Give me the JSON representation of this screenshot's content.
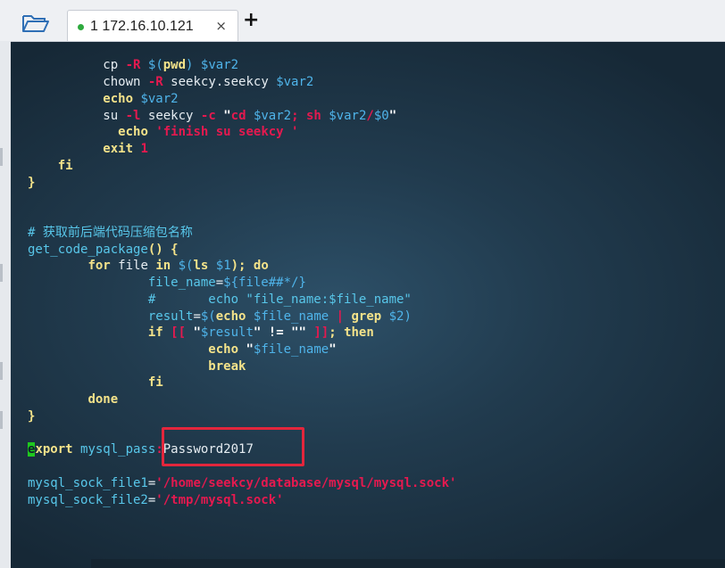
{
  "toolbar": {
    "folder_icon": "folder-open-icon"
  },
  "tabs": [
    {
      "status": "connected",
      "status_color": "#2eaa3e",
      "label": "1 172.16.10.121",
      "close": "×"
    }
  ],
  "new_tab_label": "+",
  "terminal": {
    "background": "#213b4e",
    "lines": {
      "l1": {
        "a": "cp ",
        "b": "-R ",
        "c": "$(",
        "d": "pwd",
        "e": ") ",
        "f": "$var2"
      },
      "l2": {
        "a": "chown ",
        "b": "-R ",
        "c": "seekcy.seekcy ",
        "d": "$var2"
      },
      "l3": {
        "a": "echo ",
        "b": "$var2"
      },
      "l4": {
        "a": "su ",
        "b": "-l ",
        "c": "seekcy ",
        "d": "-c ",
        "e": "\"",
        "f": "cd ",
        "g": "$var2",
        "h": "; ",
        "i": "sh ",
        "j": "$var2",
        "k": "/",
        "l": "$0",
        "m": "\""
      },
      "l5": {
        "a": "echo ",
        "b": "'finish su seekcy '"
      },
      "l6": {
        "a": "exit ",
        "b": "1"
      },
      "l7": {
        "a": "fi"
      },
      "l8": {
        "a": "}"
      },
      "l9": {
        "a": "# 获取前后端代码压缩包名称"
      },
      "l10": {
        "a": "get_code_package",
        "b": "() {"
      },
      "l11": {
        "a": "for ",
        "b": "file ",
        "c": "in ",
        "d": "$(",
        "e": "ls ",
        "f": "$1",
        "g": "); ",
        "h": "do"
      },
      "l12": {
        "a": "file_name",
        "b": "=",
        "c": "${file##*/}"
      },
      "l13": {
        "a": "#       echo \"file_name:$file_name\""
      },
      "l14": {
        "a": "result",
        "b": "=",
        "c": "$(",
        "d": "echo ",
        "e": "$file_name ",
        "f": "| ",
        "g": "grep ",
        "h": "$2",
        "i": ")"
      },
      "l15": {
        "a": "if ",
        "b": "[[ ",
        "c": "\"",
        "d": "$result",
        "e": "\" ",
        "f": "!= ",
        "g": "\"\" ",
        "h": "]]",
        "i": "; ",
        "j": "then"
      },
      "l16": {
        "a": "echo ",
        "b": "\"",
        "c": "$file_name",
        "d": "\""
      },
      "l17": {
        "a": "break"
      },
      "l18": {
        "a": "fi"
      },
      "l19": {
        "a": "done"
      },
      "l20": {
        "a": "}"
      },
      "l21": {
        "a": "e",
        "b": "xport ",
        "c": "mysql_pass",
        "d": ":",
        "e": "Password2017"
      },
      "l22": {
        "a": "mysql_sock_file1",
        "b": "=",
        "c": "'/home/seekcy/database/mysql/mysql.sock'"
      },
      "l23": {
        "a": "mysql_sock_file2",
        "b": "=",
        "c": "'/tmp/mysql.sock'"
      }
    }
  },
  "annotation": {
    "color": "#e3263c"
  }
}
